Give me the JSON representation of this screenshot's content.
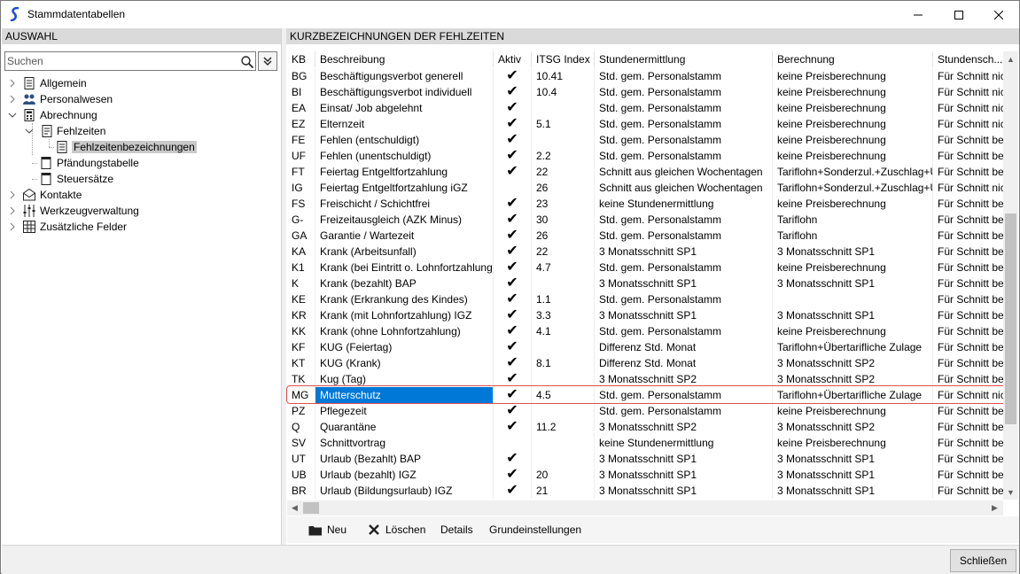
{
  "window": {
    "title": "Stammdatentabellen"
  },
  "left": {
    "header": "AUSWAHL",
    "search_placeholder": "Suchen",
    "tree": [
      {
        "label": "Allgemein",
        "icon": "list-icon"
      },
      {
        "label": "Personalwesen",
        "icon": "people-icon"
      },
      {
        "label": "Abrechnung",
        "icon": "calculator-icon"
      },
      {
        "label": "Fehlzeiten",
        "icon": "document-icon"
      },
      {
        "label": "Fehlzeitenbezeichnungen",
        "icon": "table-document-icon"
      },
      {
        "label": "Pfändungstabelle",
        "icon": "sheet-icon"
      },
      {
        "label": "Steuersätze",
        "icon": "sheet-icon"
      },
      {
        "label": "Kontakte",
        "icon": "mail-icon"
      },
      {
        "label": "Werkzeugverwaltung",
        "icon": "tools-icon"
      },
      {
        "label": "Zusätzliche Felder",
        "icon": "grid-icon"
      }
    ]
  },
  "right": {
    "header": "KURZBEZEICHNUNGEN DER FEHLZEITEN",
    "columns": [
      "KB",
      "Beschreibung",
      "Aktiv",
      "ITSG Index",
      "Stundenermittlung",
      "Berechnung",
      "Stundensch..."
    ],
    "rows": [
      [
        "BG",
        "Beschäftigungsverbot generell",
        "✔",
        "10.41",
        "Std. gem. Personalstamm",
        "keine Preisberechnung",
        "Für Schnitt nic"
      ],
      [
        "BI",
        "Beschäftigungsverbot individuell",
        "✔",
        "10.4",
        "Std. gem. Personalstamm",
        "keine Preisberechnung",
        "Für Schnitt nic"
      ],
      [
        "EA",
        "Einsat/ Job abgelehnt",
        "✔",
        "",
        "Std. gem. Personalstamm",
        "keine Preisberechnung",
        "Für Schnitt nic"
      ],
      [
        "EZ",
        "Elternzeit",
        "✔",
        "5.1",
        "Std. gem. Personalstamm",
        "keine Preisberechnung",
        "Für Schnitt nic"
      ],
      [
        "FE",
        "Fehlen (entschuldigt)",
        "✔",
        "",
        "Std. gem. Personalstamm",
        "keine Preisberechnung",
        "Für Schnitt be"
      ],
      [
        "UF",
        "Fehlen (unentschuldigt)",
        "✔",
        "2.2",
        "Std. gem. Personalstamm",
        "keine Preisberechnung",
        "Für Schnitt be"
      ],
      [
        "FT",
        "Feiertag Entgeltfortzahlung",
        "✔",
        "22",
        "Schnitt aus gleichen Wochentagen",
        "Tariflohn+Sonderzul.+Zuschlag+Ü",
        "Für Schnitt be"
      ],
      [
        "IG",
        "Feiertag Entgeltfortzahlung iGZ",
        "",
        "26",
        "Schnitt aus gleichen Wochentagen",
        "Tariflohn+Sonderzul.+Zuschlag+Ü",
        "Für Schnitt nic"
      ],
      [
        "FS",
        "Freischicht / Schichtfrei",
        "✔",
        "23",
        "keine Stundenermittlung",
        "keine Preisberechnung",
        "Für Schnitt be"
      ],
      [
        "G-",
        "Freizeitausgleich (AZK Minus)",
        "✔",
        "30",
        "Std. gem. Personalstamm",
        "Tariflohn",
        "Für Schnitt be"
      ],
      [
        "GA",
        "Garantie / Wartezeit",
        "✔",
        "26",
        "Std. gem. Personalstamm",
        "Tariflohn",
        "Für Schnitt be"
      ],
      [
        "KA",
        "Krank (Arbeitsunfall)",
        "✔",
        "22",
        "3 Monatsschnitt SP1",
        "3 Monatsschnitt SP1",
        "Für Schnitt be"
      ],
      [
        "K1",
        "Krank (bei Eintritt o. Lohnfortzahlung)",
        "✔",
        "4.7",
        "Std. gem. Personalstamm",
        "keine Preisberechnung",
        "Für Schnitt be"
      ],
      [
        "K",
        "Krank (bezahlt) BAP",
        "✔",
        "",
        "3 Monatsschnitt SP1",
        "3 Monatsschnitt SP1",
        "Für Schnitt be"
      ],
      [
        "KE",
        "Krank (Erkrankung des Kindes)",
        "✔",
        "1.1",
        "Std. gem. Personalstamm",
        "",
        "Für Schnitt be"
      ],
      [
        "KR",
        "Krank (mit Lohnfortzahlung) IGZ",
        "✔",
        "3.3",
        "3 Monatsschnitt SP1",
        "3 Monatsschnitt SP1",
        "Für Schnitt be"
      ],
      [
        "KK",
        "Krank (ohne Lohnfortzahlung)",
        "✔",
        "4.1",
        "Std. gem. Personalstamm",
        "keine Preisberechnung",
        "Für Schnitt be"
      ],
      [
        "KF",
        "KUG (Feiertag)",
        "✔",
        "",
        "Differenz Std. Monat",
        "Tariflohn+Übertarifliche Zulage",
        "Für Schnitt be"
      ],
      [
        "KT",
        "KUG (Krank)",
        "✔",
        "8.1",
        "Differenz Std. Monat",
        "3 Monatsschnitt SP2",
        "Für Schnitt be"
      ],
      [
        "TK",
        "Kug (Tag)",
        "✔",
        "",
        "3 Monatsschnitt SP2",
        "3 Monatsschnitt SP2",
        "Für Schnitt be"
      ],
      [
        "MG",
        "Mutterschutz",
        "✔",
        "4.5",
        "Std. gem. Personalstamm",
        "Tariflohn+Übertarifliche Zulage",
        "Für Schnitt nic"
      ],
      [
        "PZ",
        "Pflegezeit",
        "✔",
        "",
        "Std. gem. Personalstamm",
        "keine Preisberechnung",
        "Für Schnitt be"
      ],
      [
        "Q",
        "Quarantäne",
        "✔",
        "11.2",
        "3 Monatsschnitt SP2",
        "3 Monatsschnitt SP2",
        "Für Schnitt be"
      ],
      [
        "SV",
        "Schnittvortrag",
        "",
        "",
        "keine Stundenermittlung",
        "keine Preisberechnung",
        "Für Schnitt be"
      ],
      [
        "UT",
        "Urlaub (Bezahlt) BAP",
        "✔",
        "",
        "3 Monatsschnitt SP1",
        "3 Monatsschnitt SP1",
        "Für Schnitt be"
      ],
      [
        "UB",
        "Urlaub (bezahlt) IGZ",
        "✔",
        "20",
        "3 Monatsschnitt SP1",
        "3 Monatsschnitt SP1",
        "Für Schnitt be"
      ],
      [
        "BR",
        "Urlaub (Bildungsurlaub) IGZ",
        "✔",
        "21",
        "3 Monatsschnitt SP1",
        "3 Monatsschnitt SP1",
        "Für Schnitt be"
      ]
    ],
    "selected_row": 20,
    "toolbar": {
      "new_label": "Neu",
      "delete_label": "Löschen",
      "details_label": "Details",
      "settings_label": "Grundeinstellungen"
    }
  },
  "footer": {
    "close_label": "Schließen"
  },
  "colors": {
    "accent": "#0078d7",
    "highlight_border": "#e05050",
    "selection_tree": "#c9c9c9"
  }
}
